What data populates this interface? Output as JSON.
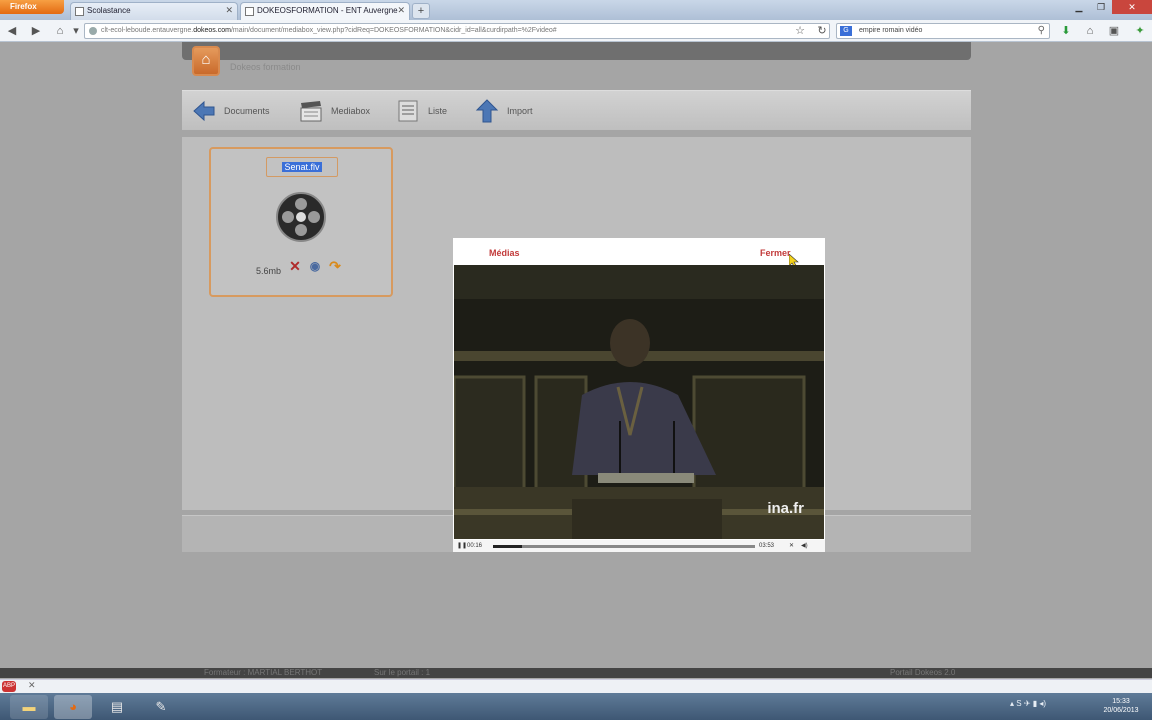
{
  "browser": {
    "firefox_button": "Firefox",
    "tabs": [
      {
        "title": "Scolastance"
      },
      {
        "title": "DOKEOSFORMATION - ENT Auvergne"
      }
    ],
    "new_tab": "+",
    "url_host": "clt-ecol-leboude.entauvergne.",
    "url_domain": "dokeos.com",
    "url_path": "/main/document/mediabox_view.php?cidReq=DOKEOSFORMATION&cidr_id=all&curdirpath=%2Fvideo#",
    "search_engine": "G",
    "search_text": "empire romain vidéo"
  },
  "portal": {
    "name": "Dokeos formation",
    "footer_trainer": "Formateur : MARTIAL BERTHOT",
    "footer_portal": "Sur le portail : 1",
    "footer_version": "Portail Dokeos 2.0"
  },
  "toolbar": {
    "items": [
      {
        "label": "Documents",
        "icon": "left-arrow-icon"
      },
      {
        "label": "Mediabox",
        "icon": "clapperboard-icon"
      },
      {
        "label": "Liste",
        "icon": "list-icon"
      },
      {
        "label": "Import",
        "icon": "up-arrow-icon"
      }
    ]
  },
  "file_card": {
    "name": "Senat.flv",
    "size": "5.6mb",
    "actions": [
      "delete-icon",
      "view-icon",
      "move-icon"
    ]
  },
  "video_popup": {
    "title": "Médias",
    "close": "Fermer",
    "watermark": "ina.fr",
    "time_current": "00:16",
    "time_total": "03:53",
    "progress": 0.11
  },
  "taskbar": {
    "clock_time": "15:33",
    "clock_date": "20/06/2013"
  },
  "colors": {
    "accent_orange": "#d79a5f",
    "popup_link_red": "#c23a3a",
    "selection_blue": "#3a6fd8"
  }
}
